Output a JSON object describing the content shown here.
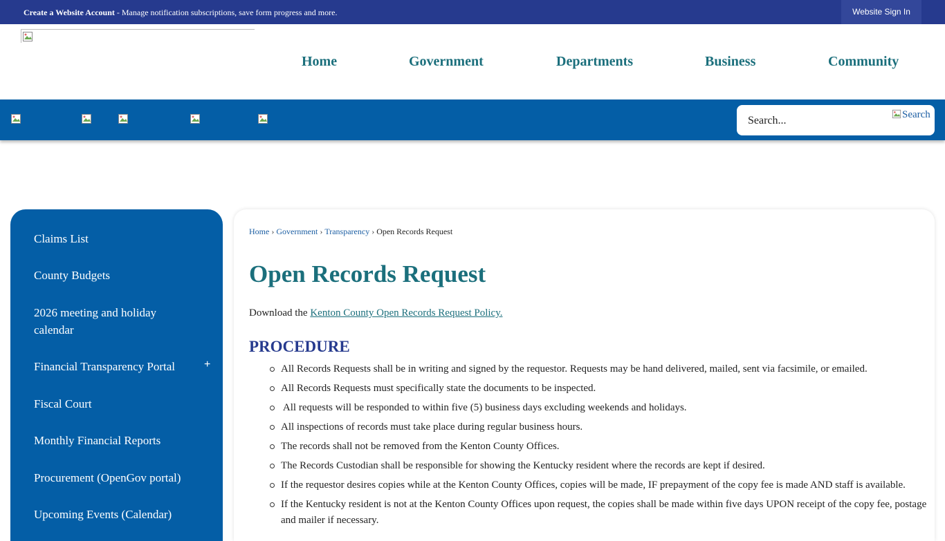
{
  "topbar": {
    "create_account_bold": "Create a Website Account",
    "create_account_rest": " - Manage notification subscriptions, save form progress and more.",
    "sign_in": "Website Sign In"
  },
  "nav": {
    "items": [
      "Home",
      "Government",
      "Departments",
      "Business",
      "Community"
    ]
  },
  "search": {
    "placeholder": "Search...",
    "button_label": "Search"
  },
  "sidebar": {
    "items": [
      "Claims List",
      "County Budgets",
      "2026 meeting and holiday calendar",
      "Financial Transparency Portal",
      "Fiscal Court",
      "Monthly Financial Reports",
      "Procurement (OpenGov portal)",
      "Upcoming Events (Calendar)"
    ],
    "expand_symbol": "+"
  },
  "breadcrumb": {
    "links": [
      "Home",
      "Government",
      "Transparency"
    ],
    "separator": "›",
    "current": "Open Records Request"
  },
  "page": {
    "title": "Open Records Request",
    "intro_text": "Download the ",
    "intro_link": "Kenton County Open Records Request Policy.",
    "section_heading": "PROCEDURE",
    "procedure": [
      "All Records Requests shall be in writing and signed by the requestor. Requests may be hand delivered, mailed, sent via facsimile, or emailed.",
      "All Records Requests must specifically state the documents to be inspected.",
      " All requests will be responded to within five (5) business days excluding weekends and holidays.",
      "All inspections of records must take place during regular business hours.",
      "The records shall not be removed from the Kenton County Offices.",
      "The Records Custodian shall be responsible for showing the Kentucky resident where the records are kept if desired.",
      "If the requestor desires copies while at the Kenton County Offices, copies will be made, IF prepayment of the copy fee is made AND staff is available.",
      "If the Kentucky resident is not at the Kenton County Offices upon request, the copies shall be made within five days UPON receipt of the copy fee, postage and mailer if necessary."
    ]
  },
  "colors": {
    "topbar_bg": "#263a8e",
    "brand_blue": "#045ea6",
    "title_teal": "#1b6f7c",
    "heading_navy": "#263a8e"
  },
  "icons": [
    "broken-image-icon",
    "search-icon"
  ]
}
